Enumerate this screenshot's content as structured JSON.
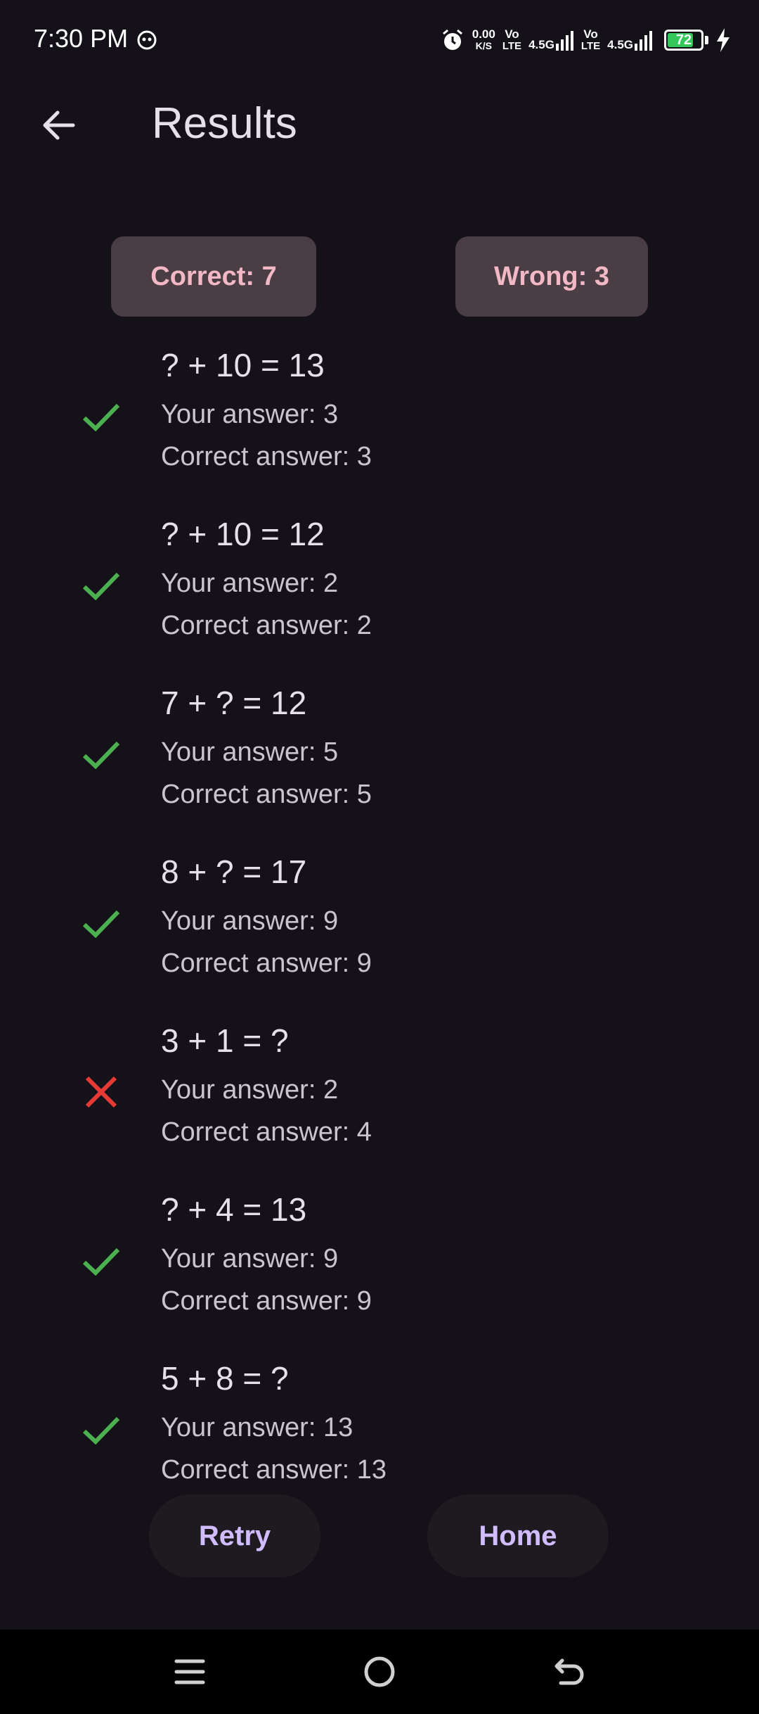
{
  "status_bar": {
    "time": "7:30 PM",
    "net_speed_value": "0.00",
    "net_speed_unit": "K/S",
    "sim1_top": "Vo",
    "sim1_bottom": "LTE",
    "sim1_net": "4.5G",
    "sim2_top": "Vo",
    "sim2_bottom": "LTE",
    "sim2_net": "4.5G",
    "battery_level": "72"
  },
  "app_bar": {
    "title": "Results"
  },
  "summary": {
    "correct_label": "Correct: 7",
    "wrong_label": "Wrong: 3"
  },
  "results": [
    {
      "question": "? + 10 = 13",
      "your_answer": "Your answer: 3",
      "correct_answer": "Correct answer: 3",
      "is_correct": true
    },
    {
      "question": "? + 10 = 12",
      "your_answer": "Your answer: 2",
      "correct_answer": "Correct answer: 2",
      "is_correct": true
    },
    {
      "question": "7 + ? = 12",
      "your_answer": "Your answer: 5",
      "correct_answer": "Correct answer: 5",
      "is_correct": true
    },
    {
      "question": "8 + ? = 17",
      "your_answer": "Your answer: 9",
      "correct_answer": "Correct answer: 9",
      "is_correct": true
    },
    {
      "question": "3 + 1 = ?",
      "your_answer": "Your answer: 2",
      "correct_answer": "Correct answer: 4",
      "is_correct": false
    },
    {
      "question": "? + 4 = 13",
      "your_answer": "Your answer: 9",
      "correct_answer": "Correct answer: 9",
      "is_correct": true
    },
    {
      "question": "5 + 8 = ?",
      "your_answer": "Your answer: 13",
      "correct_answer": "Correct answer: 13",
      "is_correct": true
    }
  ],
  "actions": {
    "retry_label": "Retry",
    "home_label": "Home"
  },
  "colors": {
    "background": "#141218",
    "correct_icon": "#4caf50",
    "wrong_icon": "#e53935",
    "chip_bg": "#4a3d43",
    "chip_text": "#f2b8c6",
    "button_text": "#d0bcff"
  },
  "icons": {
    "back": "arrow-left-icon",
    "correct": "check-icon",
    "wrong": "close-icon",
    "nav_menu": "menu-icon",
    "nav_home": "home-circle-icon",
    "nav_back": "back-icon"
  }
}
